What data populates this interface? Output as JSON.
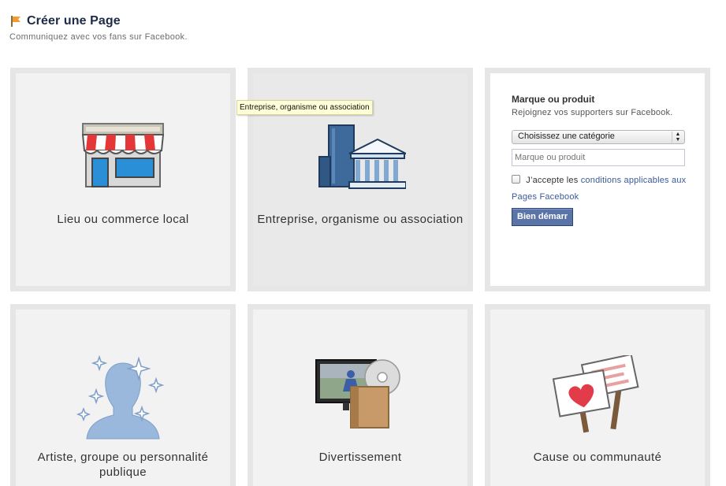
{
  "header": {
    "title": "Créer une Page",
    "subtitle": "Communiquez avec vos fans sur Facebook."
  },
  "tiles": [
    {
      "label": "Lieu ou commerce local",
      "icon": "storefront-icon"
    },
    {
      "label": "Entreprise, organisme ou association",
      "icon": "buildings-icon"
    },
    {
      "label": "Artiste, groupe ou personnalité publique",
      "icon": "artist-silhouette-icon"
    },
    {
      "label": "Divertissement",
      "icon": "entertainment-media-icon"
    },
    {
      "label": "Cause ou communauté",
      "icon": "protest-signs-icon"
    }
  ],
  "form": {
    "title": "Marque ou produit",
    "subtitle": "Rejoignez vos supporters sur Facebook.",
    "category_select": "Choisissez une catégorie",
    "name_placeholder": "Marque ou produit",
    "terms_prefix": "J’accepte les",
    "terms_link": "conditions applicables aux Pages Facebook",
    "submit": "Bien démarr"
  },
  "tooltip": "Entreprise, organisme ou association",
  "colors": {
    "title": "#1c2a47",
    "link": "#3b5998",
    "button": "#5b74a8",
    "tile_border": "#e6e6e6",
    "tile_bg": "#f2f2f2"
  }
}
